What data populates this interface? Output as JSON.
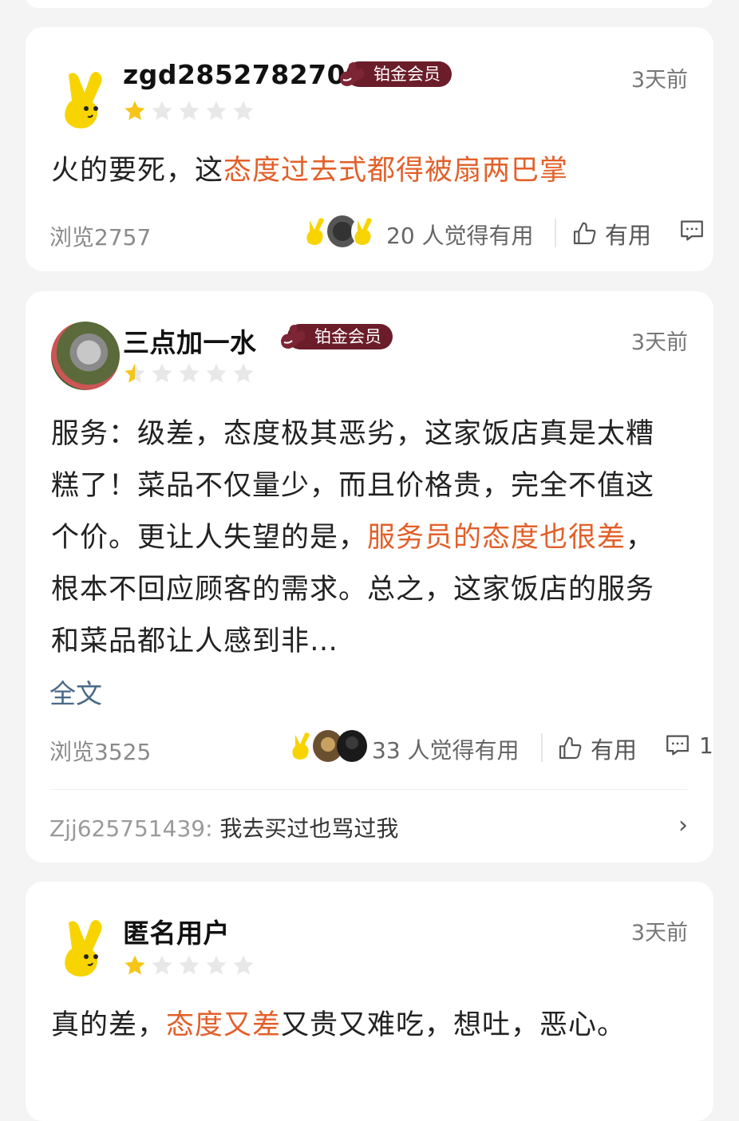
{
  "colors": {
    "highlight": "#e2602a",
    "badge": "#6b1d2a",
    "star_on": "#f5c518",
    "star_off": "#e8e8e8"
  },
  "reviews": [
    {
      "username": "zgd285278270",
      "badge": "铂金会员",
      "time": "3天前",
      "rating": 1,
      "content": [
        {
          "text": "火的要死，这"
        },
        {
          "text": "态度过去式都得被扇两巴掌",
          "hl": true
        }
      ],
      "views": "浏览2757",
      "found_useful": "20 人觉得有用",
      "useful_label": "有用",
      "comment_count": ""
    },
    {
      "username": "三点加一水",
      "badge": "铂金会员",
      "time": "3天前",
      "rating": 0.5,
      "content": [
        {
          "text": "服务：级差，态度极其恶劣，这家饭店真是太糟糕了！菜品不仅量少，而且价格贵，完全不值这个价。更让人失望的是，"
        },
        {
          "text": "服务员的态度也很差",
          "hl": true
        },
        {
          "text": "，根本不回应顾客的需求。总之，这家饭店的服务和菜品都让人感到非…"
        }
      ],
      "full_text": "全文",
      "views": "浏览3525",
      "found_useful": "33 人觉得有用",
      "useful_label": "有用",
      "comment_count": "1",
      "reply": {
        "user": "Zjj625751439:",
        "text": "我去买过也骂过我"
      }
    },
    {
      "username": "匿名用户",
      "time": "3天前",
      "rating": 1,
      "content": [
        {
          "text": "真的差，"
        },
        {
          "text": "态度又差",
          "hl": true
        },
        {
          "text": "又贵又难吃，想吐，恶心。"
        }
      ]
    }
  ]
}
